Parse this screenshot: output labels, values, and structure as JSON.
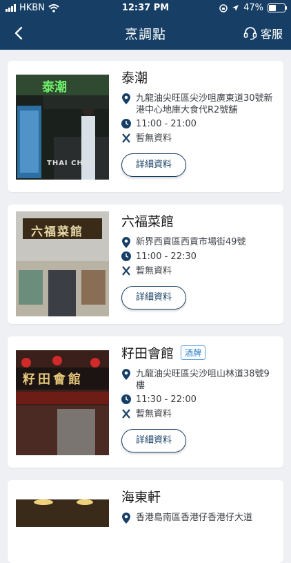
{
  "status_bar": {
    "carrier": "HKBN",
    "time": "12:37 PM",
    "battery": "47%",
    "battery_level": 0.47
  },
  "nav": {
    "title": "烹調點",
    "service_label": "客服"
  },
  "restaurants": [
    {
      "name": "泰潮",
      "address": "九龍油尖旺區尖沙咀廣東道30號新港中心地庫大食代R2號舖",
      "hours": "11:00 - 21:00",
      "cuisine": "暫無資料",
      "details_label": "詳細資料",
      "photo_sign": "泰潮",
      "photo_sign2": "THAI CHIU"
    },
    {
      "name": "六福菜館",
      "address": "新界西貢區西貢市場街49號",
      "hours": "11:00 - 22:30",
      "cuisine": "暫無資料",
      "details_label": "詳細資料",
      "photo_sign": "六福菜館"
    },
    {
      "name": "籽田會館",
      "badge": "酒牌",
      "address": "九龍油尖旺區尖沙咀山林道38號9樓",
      "hours": "11:30 - 22:00",
      "cuisine": "暫無資料",
      "details_label": "詳細資料",
      "photo_sign": "籽田會館"
    },
    {
      "name": "海東軒",
      "address": "香港島南區香港仔香港仔大道"
    }
  ]
}
